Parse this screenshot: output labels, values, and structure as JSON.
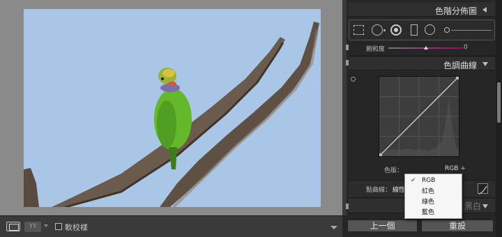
{
  "toolbar": {
    "yy_label": "YY",
    "softproof_label": "軟校樣"
  },
  "panel": {
    "histogram_title": "色階分佈圖",
    "saturation_label": "飽和度",
    "saturation_value": "0",
    "saturation_level": 0.5,
    "tone_curve_title": "色調曲線",
    "channel_label": "色版：",
    "channel_value": "RGB ÷",
    "point_curve_label": "點曲線：",
    "point_curve_value": "線性",
    "bw_title": "黑白",
    "prev_button": "上一個",
    "reset_button": "重設"
  },
  "dropdown": {
    "items": [
      {
        "label": "RGB",
        "checked": true
      },
      {
        "label": "紅色",
        "checked": false
      },
      {
        "label": "綠色",
        "checked": false
      },
      {
        "label": "藍色",
        "checked": false
      }
    ]
  },
  "icons": [
    "view-mode-icon",
    "compare-icon",
    "crop-icon",
    "spot-removal-icon",
    "red-eye-icon",
    "graduated-filter-icon",
    "radial-filter-icon",
    "adjustment-brush-icon",
    "target-adjust-icon",
    "point-curve-edit-icon"
  ],
  "colors": {
    "sky": "#a9c6e6",
    "panel_bg": "#262626",
    "canvas_bg": "#8a8a8a",
    "dropdown_check": "#3a7bd5"
  }
}
